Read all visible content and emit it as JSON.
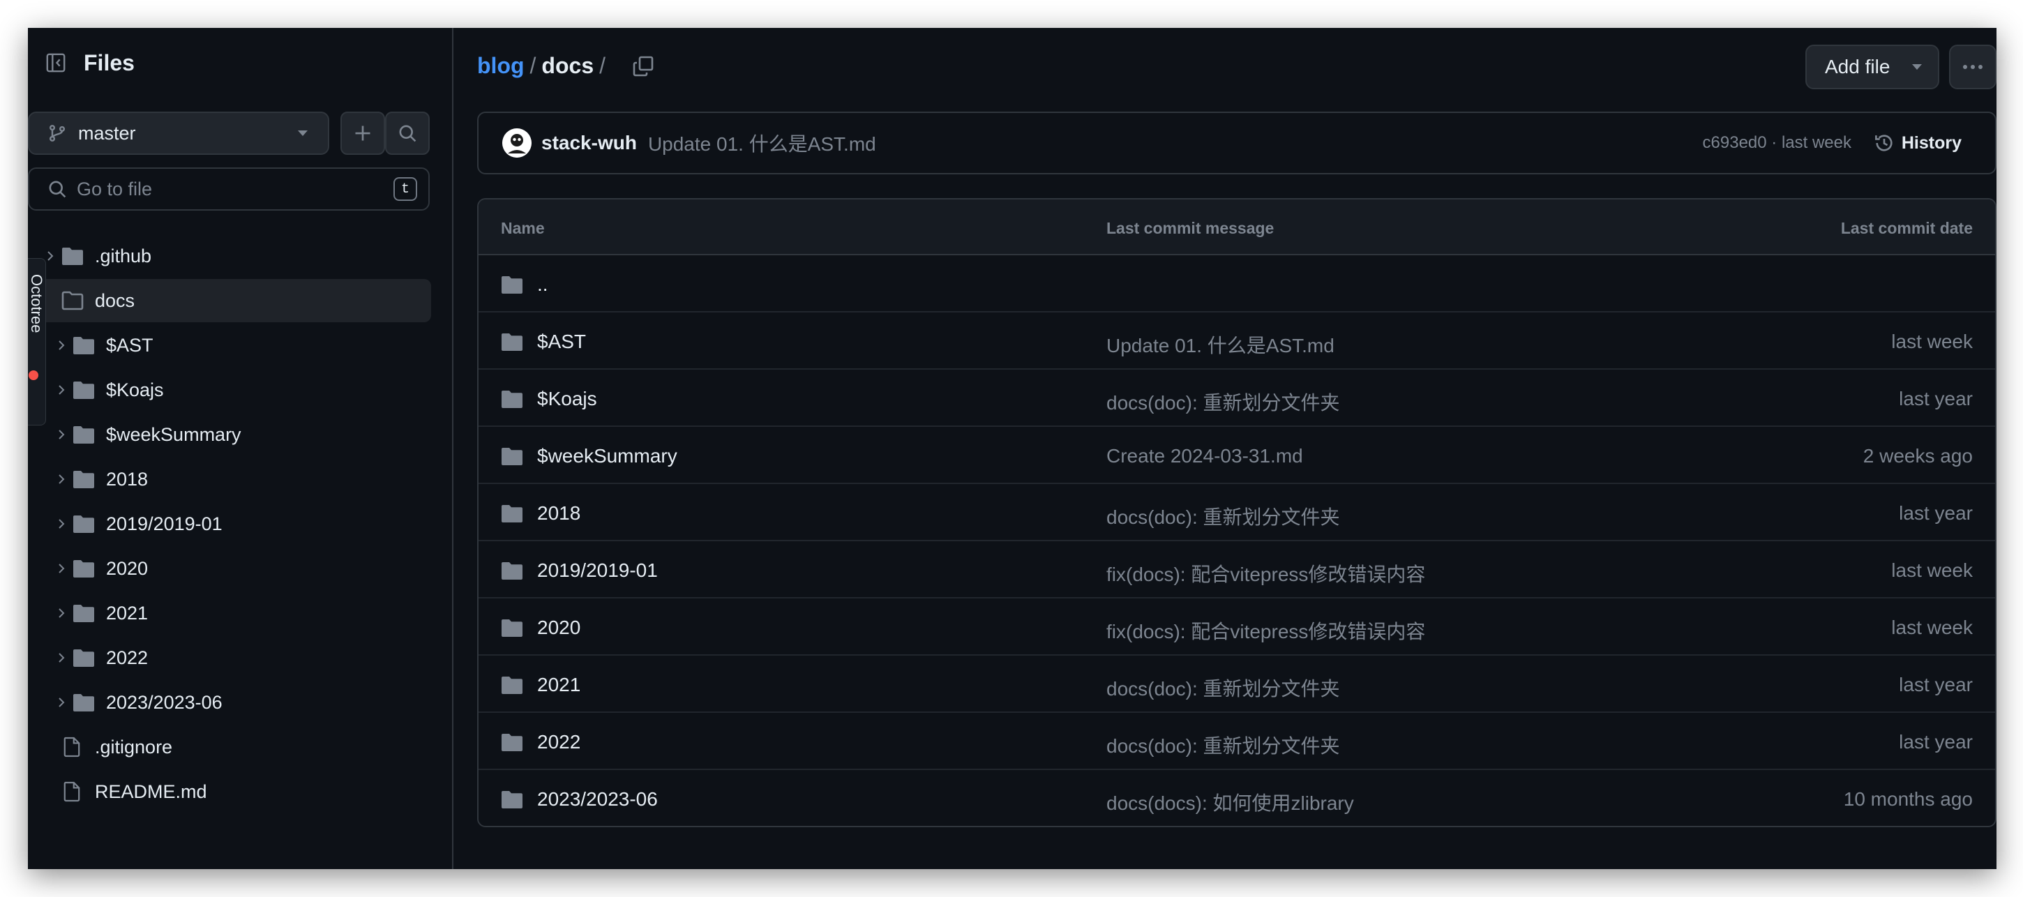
{
  "sidebar": {
    "title": "Files",
    "branch": "master",
    "goto_placeholder": "Go to file",
    "goto_shortcut": "t",
    "side_tab_label": "Octotree",
    "tree": [
      {
        "name": ".github",
        "type": "folder",
        "level": 0,
        "expandable": true,
        "selected": false
      },
      {
        "name": "docs",
        "type": "folder-open",
        "level": 0,
        "expandable": false,
        "selected": true
      },
      {
        "name": "$AST",
        "type": "folder",
        "level": 1,
        "expandable": true,
        "selected": false
      },
      {
        "name": "$Koajs",
        "type": "folder",
        "level": 1,
        "expandable": true,
        "selected": false
      },
      {
        "name": "$weekSummary",
        "type": "folder",
        "level": 1,
        "expandable": true,
        "selected": false
      },
      {
        "name": "2018",
        "type": "folder",
        "level": 1,
        "expandable": true,
        "selected": false
      },
      {
        "name": "2019/2019-01",
        "type": "folder",
        "level": 1,
        "expandable": true,
        "selected": false
      },
      {
        "name": "2020",
        "type": "folder",
        "level": 1,
        "expandable": true,
        "selected": false
      },
      {
        "name": "2021",
        "type": "folder",
        "level": 1,
        "expandable": true,
        "selected": false
      },
      {
        "name": "2022",
        "type": "folder",
        "level": 1,
        "expandable": true,
        "selected": false
      },
      {
        "name": "2023/2023-06",
        "type": "folder",
        "level": 1,
        "expandable": true,
        "selected": false
      },
      {
        "name": ".gitignore",
        "type": "file",
        "level": 0,
        "expandable": false,
        "selected": false
      },
      {
        "name": "README.md",
        "type": "file",
        "level": 0,
        "expandable": false,
        "selected": false
      }
    ]
  },
  "breadcrumb": {
    "repo": "blog",
    "sep": "/",
    "current": "docs",
    "trail": "/"
  },
  "toolbar": {
    "add_file_label": "Add file"
  },
  "commit": {
    "author": "stack-wuh",
    "message": "Update 01. 什么是AST.md",
    "meta": "c693ed0 · last week",
    "history_label": "History"
  },
  "table": {
    "headers": {
      "name": "Name",
      "message": "Last commit message",
      "date": "Last commit date"
    },
    "rows": [
      {
        "name": "..",
        "message": "",
        "date": ""
      },
      {
        "name": "$AST",
        "message": "Update 01. 什么是AST.md",
        "date": "last week"
      },
      {
        "name": "$Koajs",
        "message": "docs(doc): 重新划分文件夹",
        "date": "last year"
      },
      {
        "name": "$weekSummary",
        "message": "Create 2024-03-31.md",
        "date": "2 weeks ago"
      },
      {
        "name": "2018",
        "message": "docs(doc): 重新划分文件夹",
        "date": "last year"
      },
      {
        "name": "2019/2019-01",
        "message": "fix(docs): 配合vitepress修改错误内容",
        "date": "last week"
      },
      {
        "name": "2020",
        "message": "fix(docs): 配合vitepress修改错误内容",
        "date": "last week"
      },
      {
        "name": "2021",
        "message": "docs(doc): 重新划分文件夹",
        "date": "last year"
      },
      {
        "name": "2022",
        "message": "docs(doc): 重新划分文件夹",
        "date": "last year"
      },
      {
        "name": "2023/2023-06",
        "message": "docs(docs): 如何使用zlibrary",
        "date": "10 months ago"
      }
    ]
  },
  "colors": {
    "background": "#0d1117",
    "accent_link": "#4493f8",
    "muted_text": "#7d8590",
    "border": "#30363d",
    "folder_icon": "#7d8590"
  }
}
